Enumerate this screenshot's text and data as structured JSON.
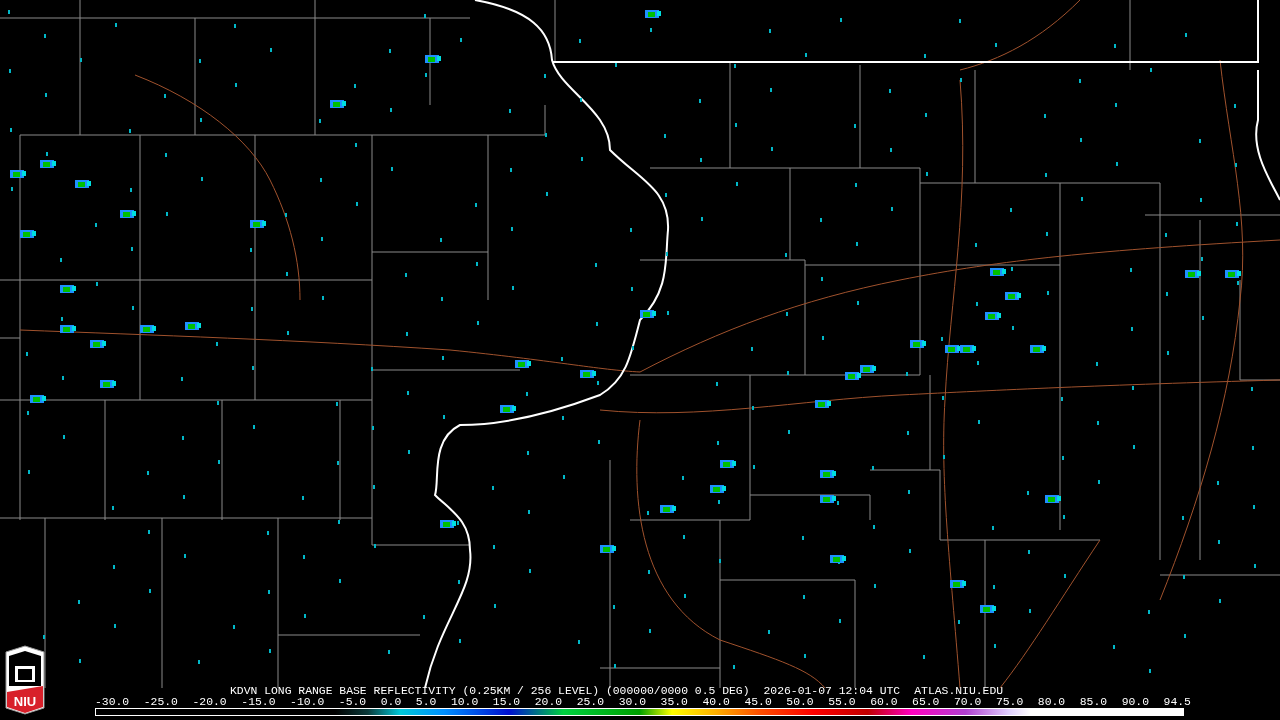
{
  "logo": {
    "text": "NIU"
  },
  "caption": {
    "product": "KDVN LONG RANGE BASE REFLECTIVITY (0.25KM / 256 LEVEL) (000000/0000 0.5 DEG)",
    "time": "2026-01-07 12:04 UTC",
    "site": "ATLAS.NIU.EDU"
  },
  "scale": {
    "ticks": [
      "-30.0",
      "-25.0",
      "-20.0",
      "-15.0",
      "-10.0",
      "-5.0",
      "0.0",
      "5.0",
      "10.0",
      "15.0",
      "20.0",
      "25.0",
      "30.0",
      "35.0",
      "40.0",
      "45.0",
      "50.0",
      "55.0",
      "60.0",
      "65.0",
      "70.0",
      "75.0",
      "80.0",
      "85.0",
      "90.0",
      "94.5"
    ]
  }
}
